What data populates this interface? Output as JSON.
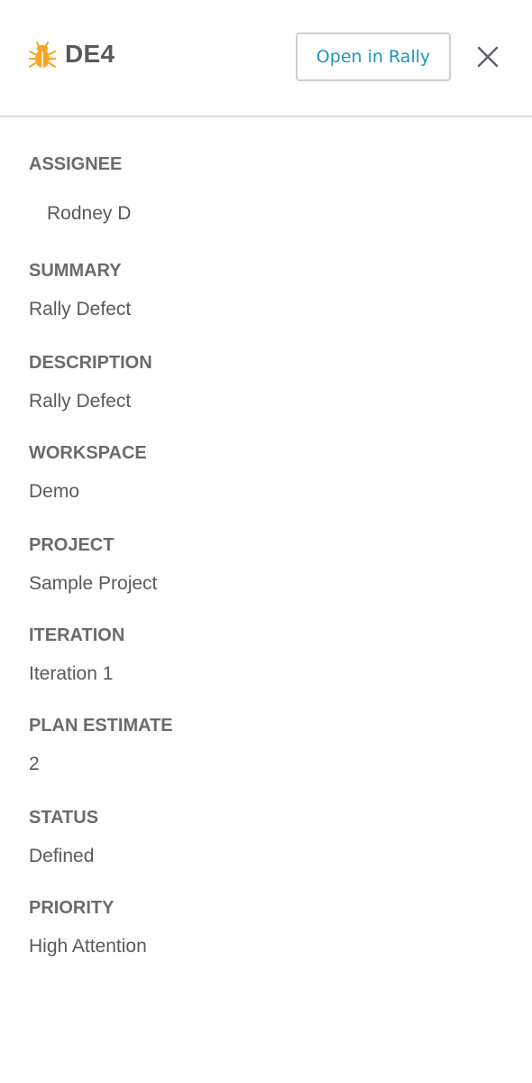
{
  "header": {
    "item_id": "DE4",
    "open_button_label": "Open in Rally",
    "item_icon": "bug-icon",
    "close_icon": "close-icon"
  },
  "colors": {
    "accent": "#1b95bd",
    "bug_icon": "#f5a623",
    "label": "#6b6b6b",
    "value": "#5a5a5a",
    "divider": "#dcdcdc"
  },
  "fields": {
    "assignee": {
      "label": "ASSIGNEE",
      "value": "Rodney D"
    },
    "summary": {
      "label": "SUMMARY",
      "value": "Rally Defect"
    },
    "description": {
      "label": "DESCRIPTION",
      "value": "Rally Defect"
    },
    "workspace": {
      "label": "WORKSPACE",
      "value": "Demo"
    },
    "project": {
      "label": "PROJECT",
      "value": "Sample Project"
    },
    "iteration": {
      "label": "ITERATION",
      "value": "Iteration 1"
    },
    "plan_estimate": {
      "label": "PLAN ESTIMATE",
      "value": "2"
    },
    "status": {
      "label": "STATUS",
      "value": "Defined"
    },
    "priority": {
      "label": "PRIORITY",
      "value": "High Attention"
    }
  }
}
